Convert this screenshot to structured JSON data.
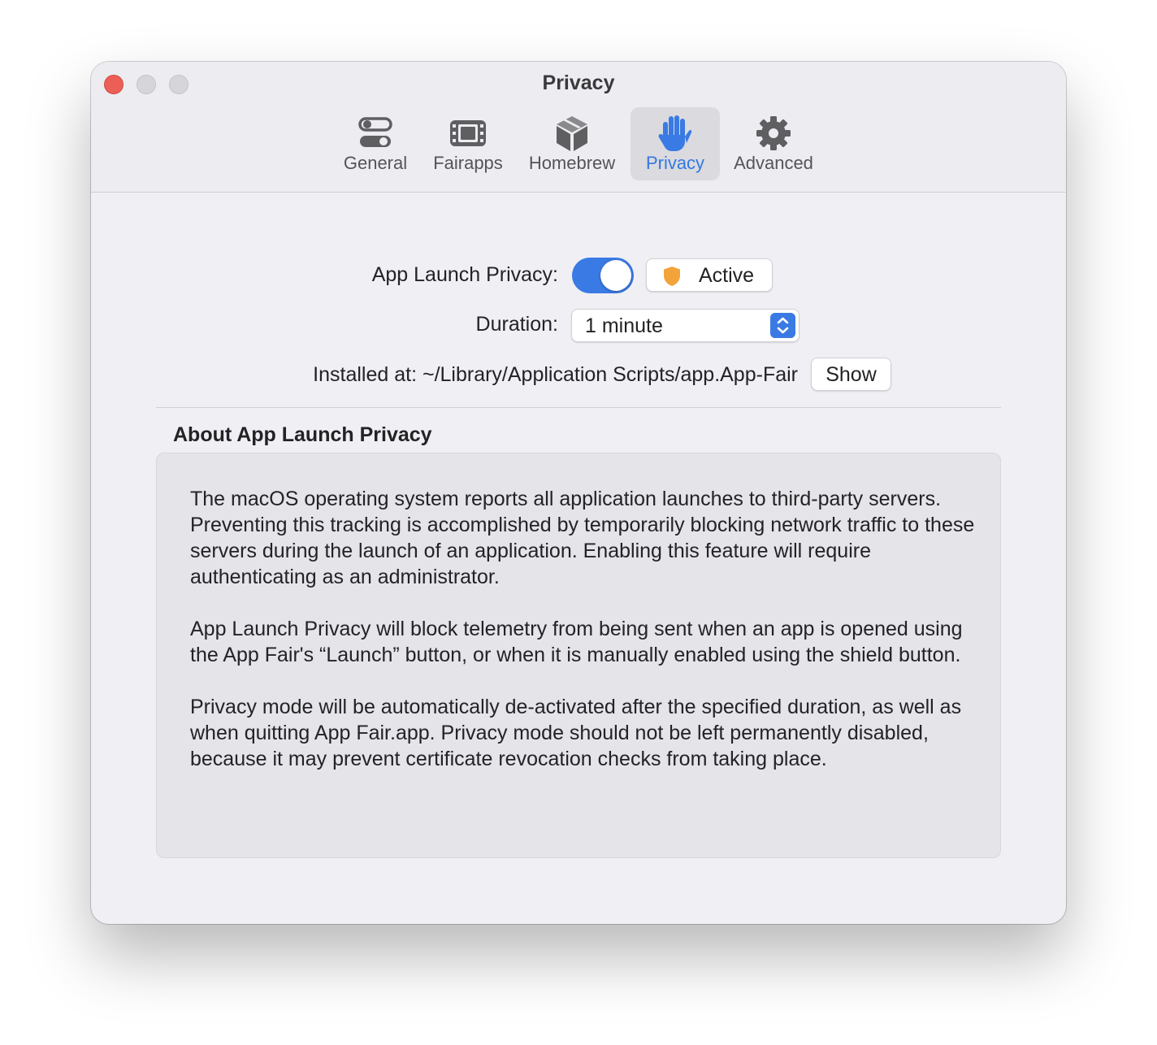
{
  "window": {
    "title": "Privacy"
  },
  "tabs": [
    {
      "label": "General",
      "icon": "switches-icon",
      "selected": false
    },
    {
      "label": "Fairapps",
      "icon": "film-icon",
      "selected": false
    },
    {
      "label": "Homebrew",
      "icon": "package-icon",
      "selected": false
    },
    {
      "label": "Privacy",
      "icon": "hand-raised-icon",
      "selected": true
    },
    {
      "label": "Advanced",
      "icon": "gear-icon",
      "selected": false
    }
  ],
  "settings": {
    "launch_privacy_label": "App Launch Privacy:",
    "launch_privacy_enabled": true,
    "status_button_label": "Active",
    "duration_label": "Duration:",
    "duration_value": "1 minute",
    "installed_label": "Installed at: ~/Library/Application Scripts/app.App-Fair",
    "show_button_label": "Show"
  },
  "about": {
    "title": "About App Launch Privacy",
    "paragraphs": [
      "The macOS operating system reports all application launches to third-party servers. Preventing this tracking is accomplished by temporarily blocking network traffic to these servers during the launch of an application. Enabling this feature will require authenticating as an administrator.",
      "App Launch Privacy will block telemetry from being sent when an app is opened using the App Fair's “Launch” button, or when it is manually enabled using the shield button.",
      "Privacy mode will be automatically de-activated after the specified duration, as well as when quitting App Fair.app. Privacy mode should not be left permanently disabled, because it may prevent certificate revocation checks from taking place."
    ]
  },
  "colors": {
    "accent": "#3a7ae4",
    "shield": "#f2a33a",
    "close_button": "#ec5f57"
  }
}
